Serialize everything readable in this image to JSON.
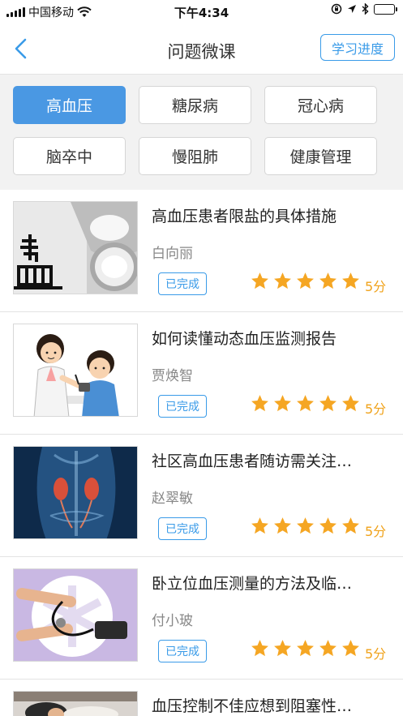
{
  "status_bar": {
    "carrier": "中国移动",
    "time": "下午4:34"
  },
  "nav": {
    "title": "问题微课",
    "progress_button": "学习进度"
  },
  "tags": [
    {
      "label": "高血压",
      "active": true
    },
    {
      "label": "糖尿病",
      "active": false
    },
    {
      "label": "冠心病",
      "active": false
    },
    {
      "label": "脑卒中",
      "active": false
    },
    {
      "label": "慢阻肺",
      "active": false
    },
    {
      "label": "健康管理",
      "active": false
    }
  ],
  "courses": [
    {
      "title": "高血压患者限盐的具体措施",
      "author": "白向丽",
      "status": "已完成",
      "score": "5分",
      "stars": 5,
      "thumb": "salt-photo"
    },
    {
      "title": "如何读懂动态血压监测报告",
      "author": "贾焕智",
      "status": "已完成",
      "score": "5分",
      "stars": 5,
      "thumb": "doctor-patient-illustration"
    },
    {
      "title": "社区高血压患者随访需关注…",
      "author": "赵翠敏",
      "status": "已完成",
      "score": "5分",
      "stars": 5,
      "thumb": "kidney-anatomy-image"
    },
    {
      "title": "卧立位血压测量的方法及临…",
      "author": "付小玻",
      "status": "已完成",
      "score": "5分",
      "stars": 5,
      "thumb": "blood-pressure-measurement-image"
    },
    {
      "title": "血压控制不佳应想到阻塞性…",
      "thumb": "sleeping-patient-photo"
    }
  ],
  "colors": {
    "accent": "#3a9be8",
    "active_tag": "#4a98e3",
    "star": "#f5a623"
  }
}
